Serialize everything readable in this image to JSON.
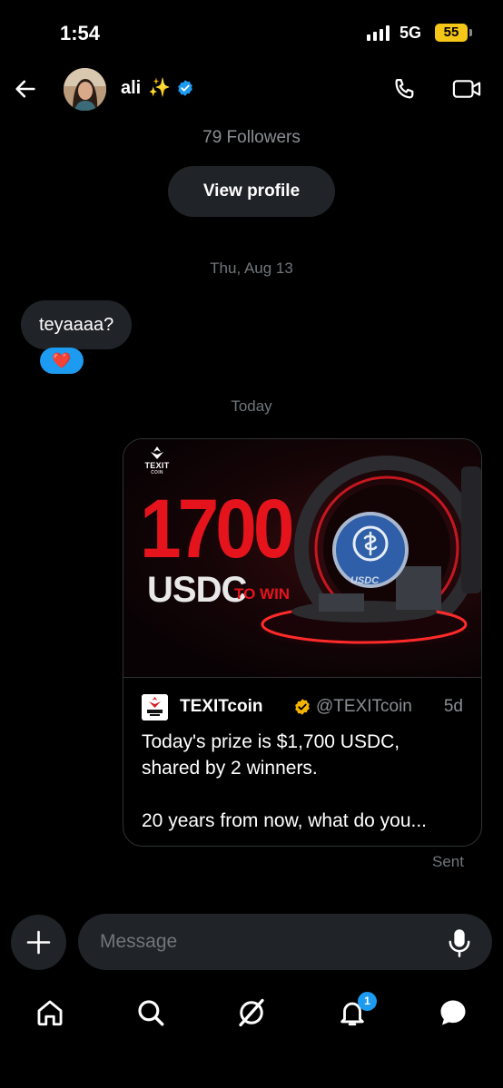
{
  "status_bar": {
    "time": "1:54",
    "network": "5G",
    "battery": "55"
  },
  "header": {
    "name": "ali",
    "sparkle": "✨"
  },
  "profile_summary": {
    "followers": "79 Followers",
    "view_profile_label": "View profile"
  },
  "dividers": {
    "date": "Thu, Aug 13",
    "today": "Today"
  },
  "messages": {
    "incoming_text": "teyaaaa?",
    "reaction": "❤️"
  },
  "shared_post": {
    "media": {
      "brand": "TEXIT",
      "brand_sub": "COIN",
      "amount": "1700",
      "currency": "USDC",
      "suffix": "TO WIN",
      "coin_label": "USDC"
    },
    "author_name": "TEXITcoin",
    "author_handle": "@TEXITcoin",
    "age": "5d",
    "text_line_1": "Today's prize is $1,700 USDC,",
    "text_line_2": "shared by 2 winners.",
    "text_line_3": "",
    "text_line_4": "20 years from now, what do you..."
  },
  "status_sent": "Sent",
  "composer": {
    "placeholder": "Message"
  },
  "nav": {
    "notification_count": "1"
  },
  "colors": {
    "accent": "#1d9bf0",
    "verified_gold": "#f4b400",
    "promo_red": "#e5141c",
    "battery": "#f5c518"
  }
}
